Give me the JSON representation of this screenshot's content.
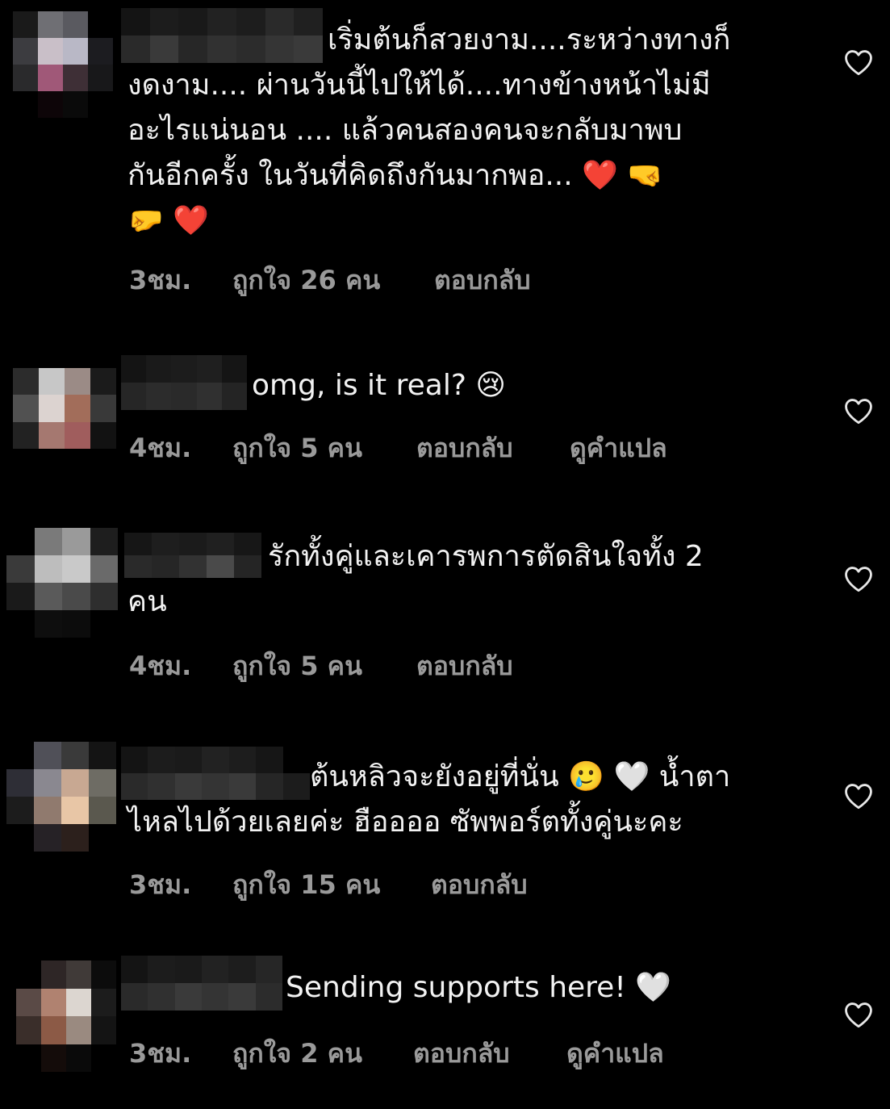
{
  "comments": [
    {
      "text": "เริ่มต้นก็สวยงาม....ระหว่างทางก็\nงดงาม.... ผ่านวันนี้ไปให้ได้....ทางข้างหน้าไม่มี\nอะไรแน่นอน .... แล้วคนสองคนจะกลับมาพบ\nกันอีกครั้ง ในวันที่คิดถึงกันมากพอ... ❤️ 🤜\n🤛 ❤️",
      "time": "3ชม.",
      "likes": "ถูกใจ 26 คน",
      "reply": "ตอบกลับ"
    },
    {
      "text": "omg, is it real? 😢",
      "time": "4ชม.",
      "likes": "ถูกใจ 5 คน",
      "reply": "ตอบกลับ",
      "translate": "ดูคำแปล"
    },
    {
      "text": "รักทั้งคู่และเคารพการตัดสินใจทั้ง 2\nคน",
      "time": "4ชม.",
      "likes": "ถูกใจ 5 คน",
      "reply": "ตอบกลับ"
    },
    {
      "text": "ต้นหลิวจะยังอยู่ที่นั่น 🥲 🤍 น้ำตา\nไหลไปด้วยเลยค่ะ ฮืออออ ซัพพอร์ตทั้งคู่นะคะ",
      "time": "3ชม.",
      "likes": "ถูกใจ 15 คน",
      "reply": "ตอบกลับ"
    },
    {
      "text": "Sending supports here! 🤍",
      "time": "3ชม.",
      "likes": "ถูกใจ 2 คน",
      "reply": "ตอบกลับ",
      "translate": "ดูคำแปล"
    }
  ],
  "icons": {
    "like": "heart-outline-icon"
  },
  "colors": {
    "background": "#000000",
    "text": "#f2f2f2",
    "meta": "#9a9a9a"
  }
}
